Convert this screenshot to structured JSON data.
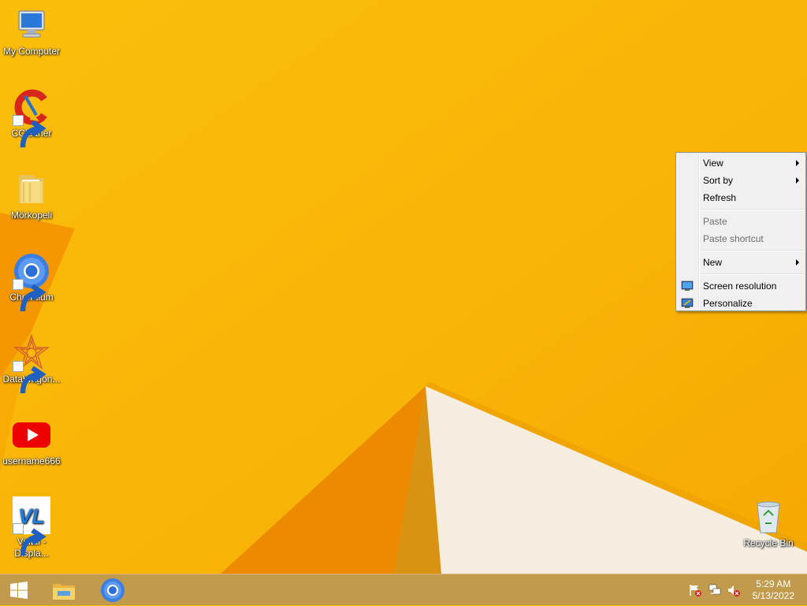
{
  "desktop": {
    "icons": [
      {
        "label": "My Computer",
        "icon": "computer-icon"
      },
      {
        "label": "CCleaner",
        "icon": "ccleaner-icon"
      },
      {
        "label": "Mörkopeli",
        "icon": "folder-icon"
      },
      {
        "label": "Chromium",
        "icon": "chromium-icon"
      },
      {
        "label": "DataWagon...",
        "icon": "datawagon-icon"
      },
      {
        "label": "username666",
        "icon": "youtube-icon"
      },
      {
        "label": "VidLii - Displa...",
        "icon": "vidlii-icon"
      },
      {
        "label": "Recycle Bin",
        "icon": "recycle-bin-icon"
      }
    ]
  },
  "context_menu": {
    "view": "View",
    "sort_by": "Sort by",
    "refresh": "Refresh",
    "paste": "Paste",
    "paste_shortcut": "Paste shortcut",
    "new": "New",
    "screen_resolution": "Screen resolution",
    "personalize": "Personalize"
  },
  "taskbar": {
    "start": "start-icon",
    "pinned": [
      "file-explorer-icon",
      "chromium-icon"
    ],
    "tray": [
      "action-center-flag-icon",
      "network-icon",
      "volume-muted-icon"
    ],
    "time": "5:29 AM",
    "date": "5/13/2022"
  },
  "colors": {
    "wallpaper": "#f7b500",
    "menu_bg": "#f0f0f0",
    "taskbar": "#c19a4c"
  }
}
